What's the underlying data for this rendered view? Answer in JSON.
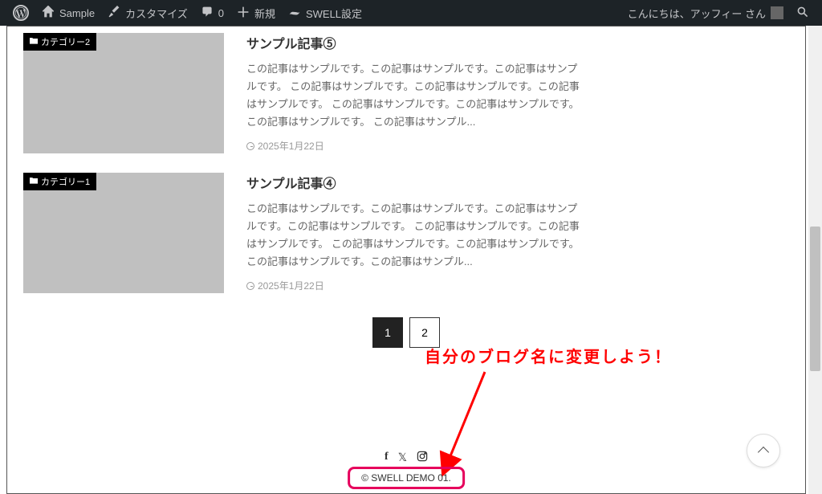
{
  "admin_bar": {
    "site_name": "Sample",
    "customize": "カスタマイズ",
    "comments": "0",
    "new": "新規",
    "swell": "SWELL設定",
    "greeting": "こんにちは、アッフィー さん"
  },
  "posts": [
    {
      "category": "カテゴリー2",
      "title": "サンプル記事⑤",
      "excerpt": "この記事はサンプルです。この記事はサンプルです。この記事はサンプルです。 この記事はサンプルです。この記事はサンプルです。この記事はサンプルです。 この記事はサンプルです。この記事はサンプルです。この記事はサンプルです。 この記事はサンプル...",
      "date": "2025年1月22日"
    },
    {
      "category": "カテゴリー1",
      "title": "サンプル記事④",
      "excerpt": "この記事はサンプルです。この記事はサンプルです。この記事はサンプルです。この記事はサンプルです。 この記事はサンプルです。この記事はサンプルです。 この記事はサンプルです。この記事はサンプルです。 この記事はサンプルです。この記事はサンプル...",
      "date": "2025年1月22日"
    }
  ],
  "pagination": {
    "current": "1",
    "pages": [
      "1",
      "2"
    ]
  },
  "annotation": "自分のブログ名に変更しよう！",
  "copyright": "© SWELL DEMO 01.",
  "icons": {
    "facebook": "f",
    "x": "𝕏",
    "instagram": "◎"
  }
}
